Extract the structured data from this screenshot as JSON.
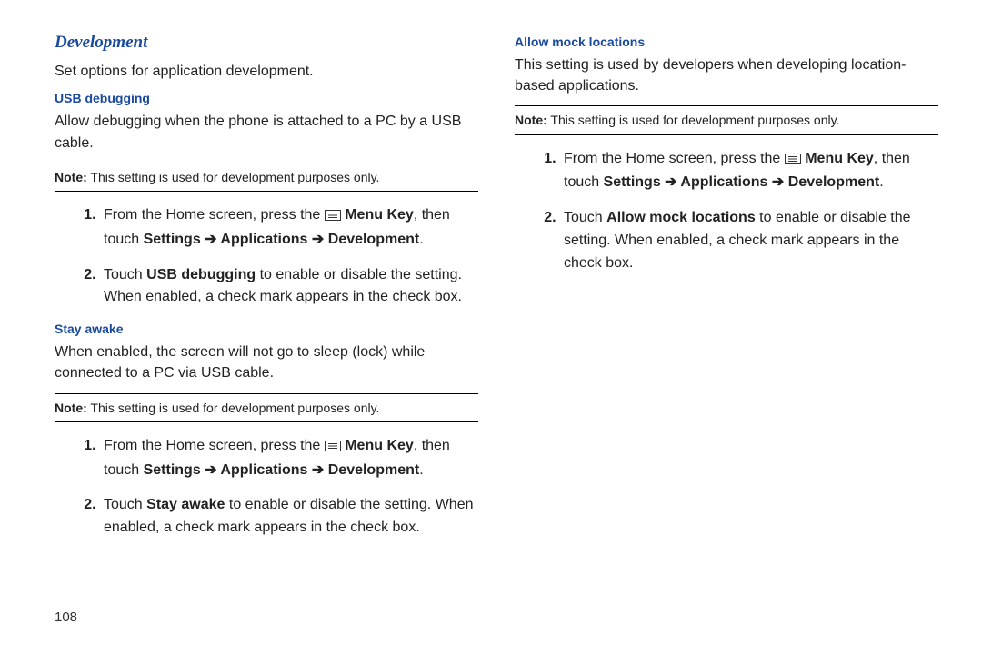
{
  "page_number": "108",
  "left": {
    "heading": "Development",
    "intro": "Set options for application development.",
    "usb": {
      "title": "USB debugging",
      "para": "Allow debugging when the phone is attached to a PC by a USB cable.",
      "note_label": "Note:",
      "note": " This setting is used for development purposes only.",
      "step1_pre": "From the Home screen, press the ",
      "step1_menukey": "Menu Key",
      "step1_mid": ", then touch ",
      "step1_path1": "Settings",
      "step1_path2": "Applications",
      "step1_path3": "Development",
      "step2_pre": "Touch ",
      "step2_bold": "USB debugging",
      "step2_post": " to enable or disable the setting. When enabled, a check mark appears in the check box."
    },
    "stay": {
      "title": "Stay awake",
      "para": "When enabled, the screen will not go to sleep (lock) while connected to a PC via USB cable.",
      "note_label": "Note:",
      "note": " This setting is used for development purposes only.",
      "step1_pre": "From the Home screen, press the ",
      "step1_menukey": "Menu Key",
      "step1_mid": ", then touch ",
      "step1_path1": "Settings",
      "step1_path2": "Applications",
      "step1_path3": "Development",
      "step2_pre": "Touch ",
      "step2_bold": "Stay awake",
      "step2_post": " to enable or disable the setting. When enabled, a check mark appears in the check box."
    }
  },
  "right": {
    "mock": {
      "title": "Allow mock locations",
      "para": "This setting is used by developers when developing location-based applications.",
      "note_label": "Note:",
      "note": " This setting is used for development purposes only.",
      "step1_pre": "From the Home screen, press the ",
      "step1_menukey": "Menu Key",
      "step1_mid": ", then touch ",
      "step1_path1": "Settings",
      "step1_path2": "Applications",
      "step1_path3": "Development",
      "step2_pre": "Touch ",
      "step2_bold": "Allow mock locations",
      "step2_post": " to enable or disable the setting. When enabled, a check mark appears in the check box."
    }
  },
  "arrow": " ➔ "
}
